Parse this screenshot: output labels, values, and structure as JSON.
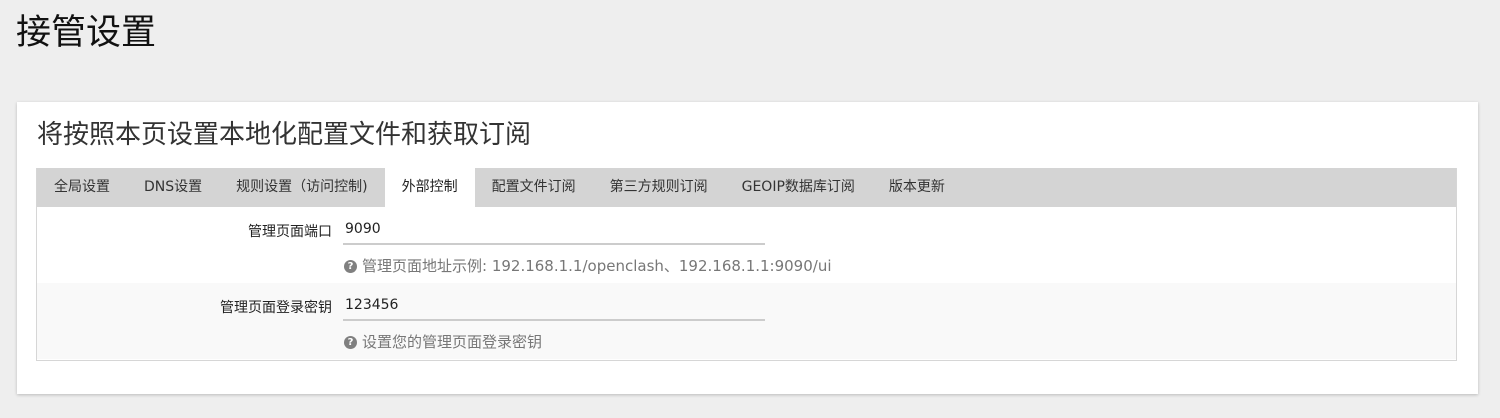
{
  "page": {
    "title": "接管设置"
  },
  "panel": {
    "title": "将按照本页设置本地化配置文件和获取订阅"
  },
  "tabs": [
    {
      "label": "全局设置",
      "active": false
    },
    {
      "label": "DNS设置",
      "active": false
    },
    {
      "label": "规则设置（访问控制)",
      "active": false
    },
    {
      "label": "外部控制",
      "active": true
    },
    {
      "label": "配置文件订阅",
      "active": false
    },
    {
      "label": "第三方规则订阅",
      "active": false
    },
    {
      "label": "GEOIP数据库订阅",
      "active": false
    },
    {
      "label": "版本更新",
      "active": false
    }
  ],
  "fields": {
    "port": {
      "label": "管理页面端口",
      "value": "9090",
      "help": "管理页面地址示例: 192.168.1.1/openclash、192.168.1.1:9090/ui",
      "help_icon": "question-circle-icon"
    },
    "secret": {
      "label": "管理页面登录密钥",
      "value": "123456",
      "help": "设置您的管理页面登录密钥",
      "help_icon": "question-circle-icon"
    }
  },
  "colors": {
    "background": "#eeeeee",
    "panel": "#ffffff",
    "tab_bar": "#d4d4d4",
    "active_tab": "#ffffff",
    "help_text": "#777777"
  }
}
